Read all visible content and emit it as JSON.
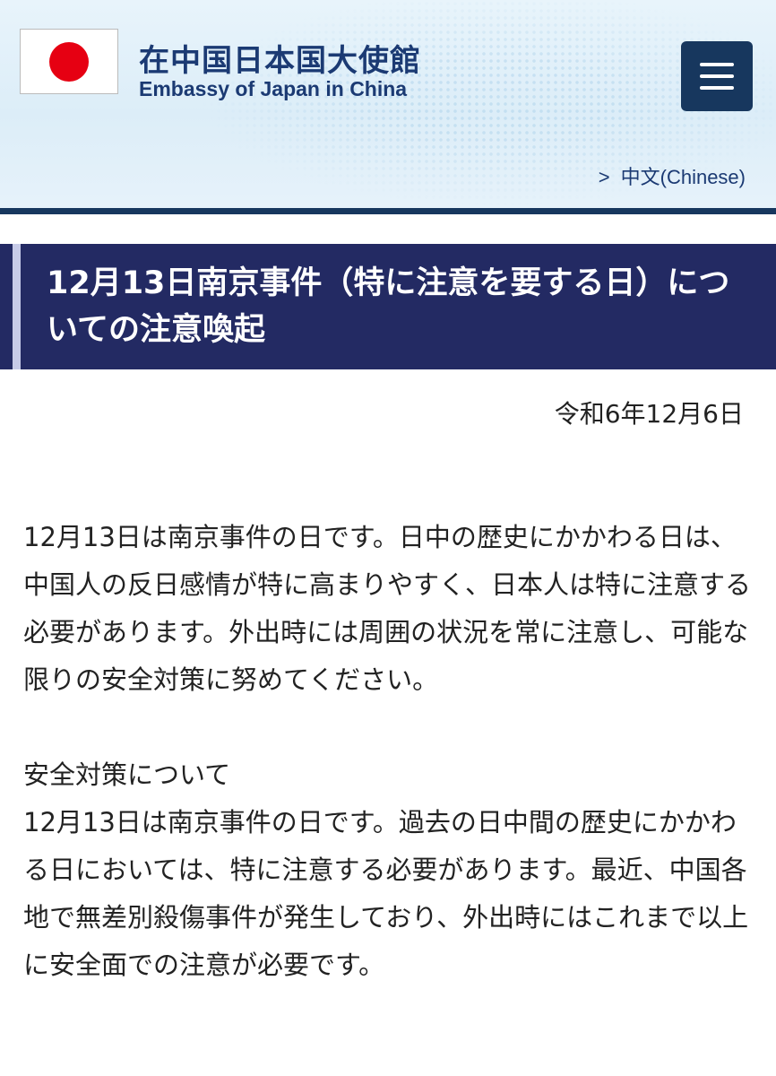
{
  "header": {
    "title_ja": "在中国日本国大使館",
    "title_en": "Embassy of Japan in China",
    "flag_icon": "japan-flag-icon",
    "menu_icon": "hamburger-menu-icon",
    "lang_link": {
      "chevron": ">",
      "label": "中文(Chinese)"
    },
    "colors": {
      "navy": "#17375e",
      "title_text": "#1b3a73",
      "flag_red": "#e60012"
    }
  },
  "article": {
    "title": "12月13日南京事件（特に注意を要する日）についての注意喚起",
    "title_bg": "#232a63",
    "date": "令和6年12月6日",
    "paragraph1": "12月13日は南京事件の日です。日中の歴史にかかわる日は、中国人の反日感情が特に高まりやすく、日本人は特に注意する必要があります。外出時には周囲の状況を常に注意し、可能な限りの安全対策に努めてください。",
    "section_heading": "安全対策について",
    "paragraph2": "12月13日は南京事件の日です。過去の日中間の歴史にかかわる日においては、特に注意する必要があります。最近、中国各地で無差別殺傷事件が発生しており、外出時にはこれまで以上に安全面での注意が必要です。"
  }
}
